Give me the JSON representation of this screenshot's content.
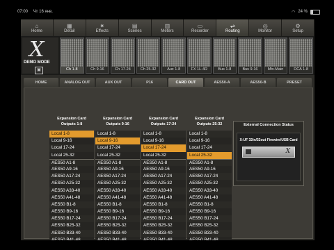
{
  "statusbar": {
    "time": "07:00",
    "date": "Чт 16 янв.",
    "battery": "24 %"
  },
  "nav": [
    {
      "label": "Home",
      "icon": "⌂"
    },
    {
      "label": "Detail",
      "icon": "▦"
    },
    {
      "label": "Effects",
      "icon": "✷"
    },
    {
      "label": "Scenes",
      "icon": "▤"
    },
    {
      "label": "Meters",
      "icon": "▥"
    },
    {
      "label": "Recorder",
      "icon": "▭"
    },
    {
      "label": "Routing",
      "icon": "⇌"
    },
    {
      "label": "Monitor",
      "icon": "◎"
    },
    {
      "label": "Setup",
      "icon": "⚙"
    }
  ],
  "demo": {
    "label": "DEMO MODE"
  },
  "meters": [
    "Ch 1-8",
    "Ch 9-16",
    "Ch 17-24",
    "Ch 25-32",
    "Aux 1-8",
    "FX 1L-4R",
    "Bus 1-8",
    "Bus 9-16",
    "Mtx-Main",
    "DCA 1-8"
  ],
  "tabs": [
    "HOME",
    "ANALOG OUT",
    "AUX OUT",
    "P16",
    "CARD OUT",
    "AES50-A",
    "AES50-B",
    "PRESET"
  ],
  "columns": [
    {
      "head1": "Expansion Card",
      "head2": "Outputs 1-8"
    },
    {
      "head1": "Expansion Card",
      "head2": "Outputs 9-16"
    },
    {
      "head1": "Expansion Card",
      "head2": "Outputs 17-24"
    },
    {
      "head1": "Expansion Card",
      "head2": "Outputs 25-32"
    }
  ],
  "sources": [
    "Local 1-8",
    "Local 9-16",
    "Local 17-24",
    "Local 25-32",
    "AES50 A1-8",
    "AES50 A9-16",
    "AES50 A17-24",
    "AES50 A25-32",
    "AES50 A33-40",
    "AES50 A41-48",
    "AES50 B1-8",
    "AES50 B9-16",
    "AES50 B17-24",
    "AES50 B25-32",
    "AES50 B33-40",
    "AES50 B41-48"
  ],
  "selected": [
    0,
    1,
    2,
    3
  ],
  "external": {
    "title": "External Connection Status",
    "card_name": "X-UF 32in/32out Firewire/USB Card"
  }
}
